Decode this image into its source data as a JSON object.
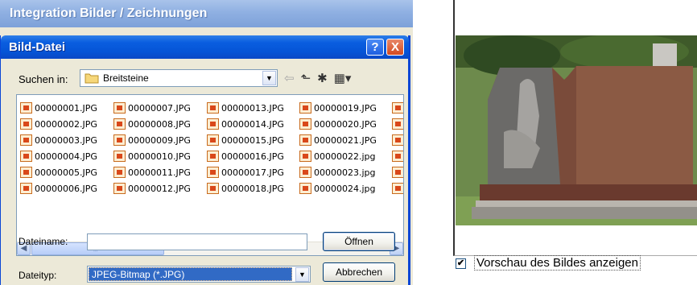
{
  "outer_window": {
    "title": "Integration Bilder / Zeichnungen"
  },
  "dialog": {
    "title": "Bild-Datei",
    "help_label": "?",
    "close_label": "X",
    "look_in_label": "Suchen in:",
    "look_in_value": "Breitsteine",
    "files": [
      [
        "00000001.JPG",
        "00000002.JPG",
        "00000003.JPG",
        "00000004.JPG",
        "00000005.JPG",
        "00000006.JPG"
      ],
      [
        "00000007.JPG",
        "00000008.JPG",
        "00000009.JPG",
        "00000010.JPG",
        "00000011.JPG",
        "00000012.JPG"
      ],
      [
        "00000013.JPG",
        "00000014.JPG",
        "00000015.JPG",
        "00000016.JPG",
        "00000017.JPG",
        "00000018.JPG"
      ],
      [
        "00000019.JPG",
        "00000020.JPG",
        "00000021.JPG",
        "00000022.jpg",
        "00000023.jpg",
        "00000024.jpg"
      ]
    ],
    "file_name_label": "Dateiname:",
    "file_name_value": "",
    "file_type_label": "Dateityp:",
    "file_type_value": "JPEG-Bitmap (*.JPG)",
    "open_button": "Öffnen",
    "cancel_button": "Abbrechen"
  },
  "preview": {
    "show_preview_label": "Vorschau des Bildes anzeigen",
    "show_preview_checked": true
  },
  "colors": {
    "title_blue": "#0554d6",
    "selection_blue": "#316ac5",
    "dialog_bg": "#ece9d8"
  }
}
